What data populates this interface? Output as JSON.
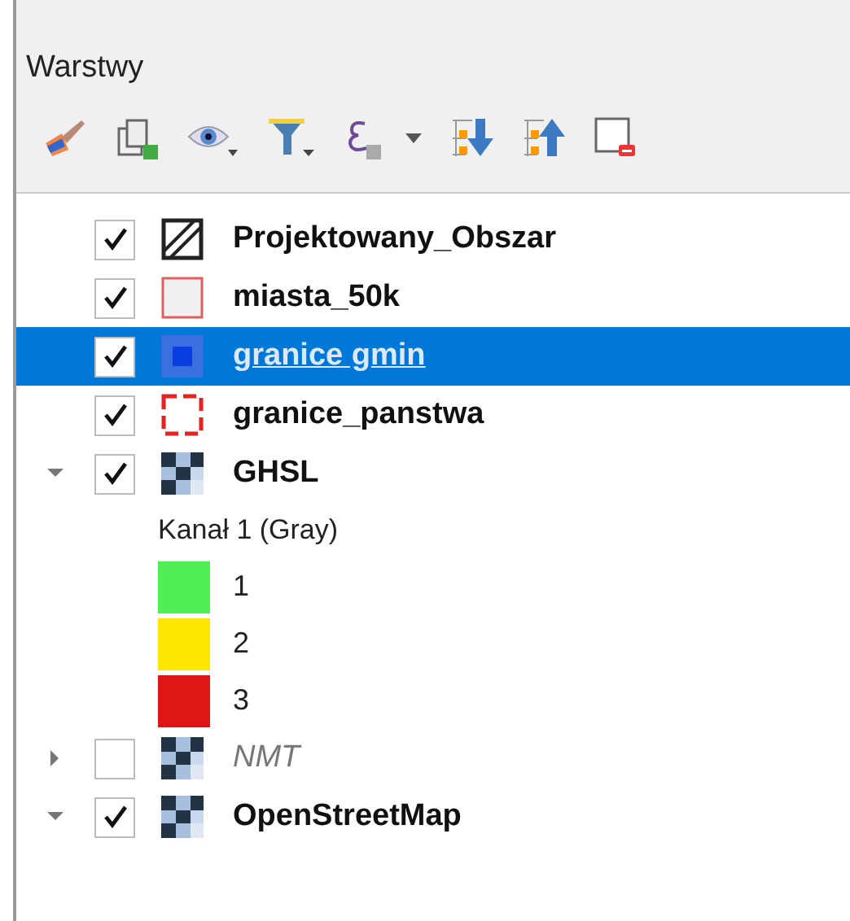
{
  "panel": {
    "title": "Warstwy"
  },
  "layers": [
    {
      "name": "Projektowany_Obszar",
      "checked": true,
      "selected": false,
      "kind": "hatched"
    },
    {
      "name": "miasta_50k",
      "checked": true,
      "selected": false,
      "kind": "outline"
    },
    {
      "name": "granice gmin",
      "checked": true,
      "selected": true,
      "kind": "solid"
    },
    {
      "name": "granice_panstwa",
      "checked": true,
      "selected": false,
      "kind": "dashed"
    },
    {
      "name": "GHSL",
      "checked": true,
      "selected": false,
      "kind": "raster",
      "expanded": true,
      "legend": {
        "band": "Kanał 1 (Gray)",
        "classes": [
          {
            "label": "1",
            "color": "#4fef55"
          },
          {
            "label": "2",
            "color": "#ffe600"
          },
          {
            "label": "3",
            "color": "#e01515"
          }
        ]
      }
    },
    {
      "name": "NMT",
      "checked": false,
      "selected": false,
      "kind": "raster",
      "expanded": false
    },
    {
      "name": "OpenStreetMap",
      "checked": true,
      "selected": false,
      "kind": "raster",
      "expanded": true
    }
  ]
}
